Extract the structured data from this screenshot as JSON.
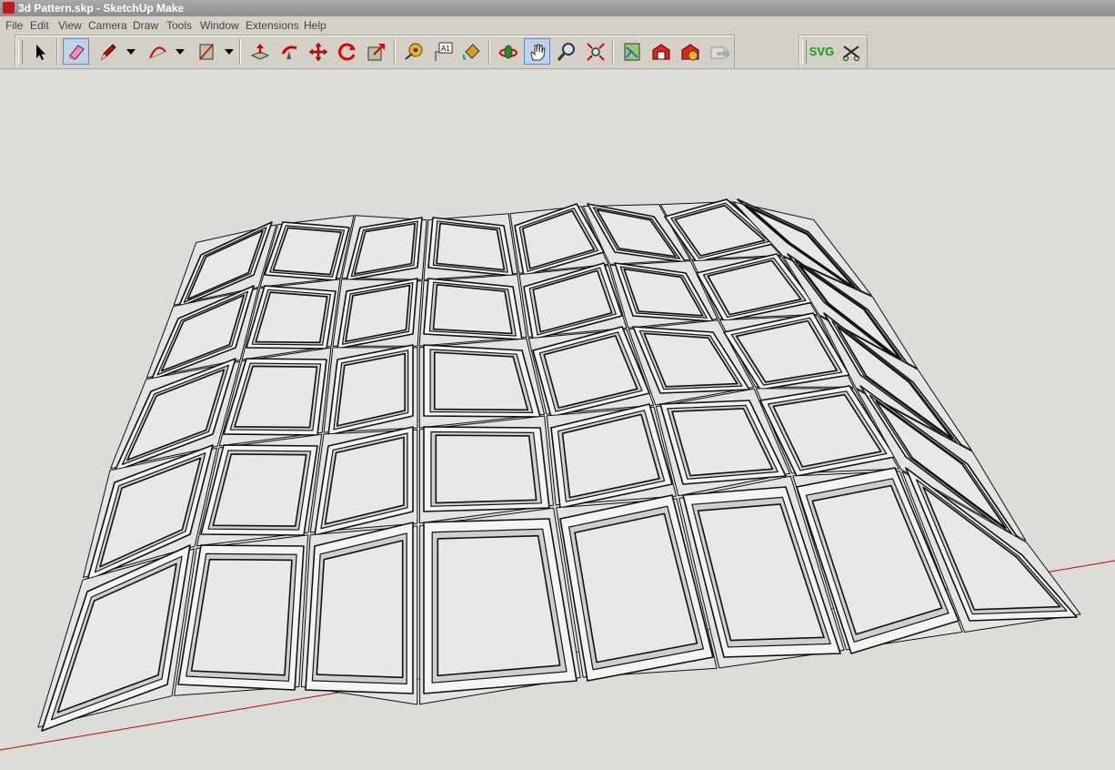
{
  "window": {
    "title": "3d Pattern.skp - SketchUp Make"
  },
  "menu": [
    "File",
    "Edit",
    "View",
    "Camera",
    "Draw",
    "Tools",
    "Window",
    "Extensions",
    "Help"
  ],
  "toolbar": {
    "tools": [
      {
        "name": "select-tool",
        "icon": "arrow-icon"
      },
      {
        "name": "eraser-tool",
        "icon": "eraser-icon",
        "active": true
      },
      {
        "name": "pencil-tool",
        "icon": "pencil-icon"
      },
      {
        "name": "arc-tool",
        "icon": "arc-icon"
      },
      {
        "name": "rectangle-tool",
        "icon": "rectangle-icon"
      },
      {
        "name": "push-pull-tool",
        "icon": "push-pull-icon"
      },
      {
        "name": "follow-me-tool",
        "icon": "follow-me-icon"
      },
      {
        "name": "move-tool",
        "icon": "move-icon"
      },
      {
        "name": "rotate-tool",
        "icon": "rotate-icon"
      },
      {
        "name": "scale-tool",
        "icon": "scale-icon"
      },
      {
        "name": "tape-measure-tool",
        "icon": "tape-measure-icon"
      },
      {
        "name": "text-tool",
        "icon": "text-icon"
      },
      {
        "name": "paint-bucket-tool",
        "icon": "paint-bucket-icon"
      },
      {
        "name": "orbit-tool",
        "icon": "orbit-icon"
      },
      {
        "name": "pan-tool",
        "icon": "hand-icon",
        "active": true
      },
      {
        "name": "zoom-tool",
        "icon": "magnifier-icon"
      },
      {
        "name": "zoom-extents-tool",
        "icon": "zoom-extents-icon"
      },
      {
        "name": "add-location-tool",
        "icon": "map-icon"
      },
      {
        "name": "3d-warehouse-tool",
        "icon": "warehouse-icon"
      },
      {
        "name": "extension-warehouse-tool",
        "icon": "extension-icon"
      },
      {
        "name": "share-model-tool",
        "icon": "share-icon"
      }
    ],
    "plugin": {
      "svg_label": "SVG",
      "second_icon": "scissors-icon"
    }
  },
  "viewport": {
    "background": "#dcdcd8",
    "axis_color": "#cc0000"
  }
}
